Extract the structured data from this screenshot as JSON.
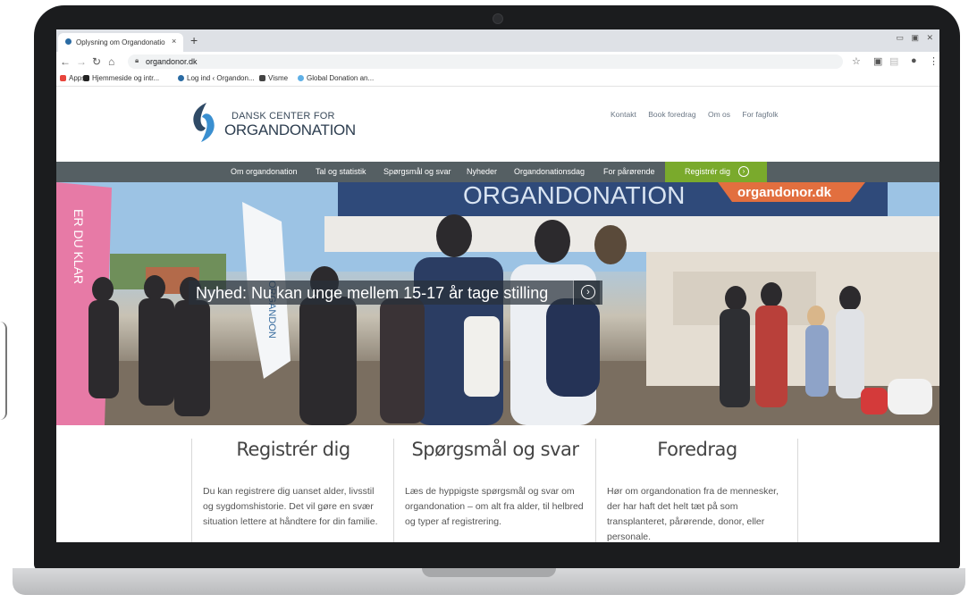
{
  "browser": {
    "tab_title": "Oplysning om Organdonation fo",
    "tab_close": "×",
    "new_tab": "+",
    "url": "organdonor.dk",
    "bookmarks": [
      {
        "label": "Apps",
        "color": "#e8453c"
      },
      {
        "label": "Hjemmeside og intr...",
        "color": "#222222"
      },
      {
        "label": "Log ind ‹ Organdon...",
        "color": "#2a6ba3"
      },
      {
        "label": "Visme",
        "color": "#444444"
      },
      {
        "label": "Global Donation an...",
        "color": "#5fb0e6"
      }
    ]
  },
  "site": {
    "logo_line1": "DANSK CENTER FOR",
    "logo_line2": "ORGANDONATION",
    "top_links": [
      "Kontakt",
      "Book foredrag",
      "Om os",
      "For fagfolk"
    ],
    "nav": [
      "Om organdonation",
      "Tal og statistik",
      "Spørgsmål og svar",
      "Nyheder",
      "Organdonationsdag",
      "For pårørende"
    ],
    "register_button": "Registrér dig",
    "brand_color": "#7aaa2c",
    "nav_color": "#555f63"
  },
  "hero": {
    "headline": "Nyhed: Nu kan unge mellem 15-17 år tage stilling",
    "banner_text": "ORGANDONATION",
    "banner_url": "organdonor.dk",
    "tent_text": "ER DU KLAR",
    "flag_text": "ORGANDON"
  },
  "cards": [
    {
      "title": "Registrér dig",
      "text": "Du kan registrere dig uanset alder, livsstil og sygdomshistorie. Det vil gøre en svær situation lettere at håndtere for din familie."
    },
    {
      "title": "Spørgsmål og svar",
      "text": "Læs de hyppigste spørgsmål og svar om organdonation – om alt fra alder, til helbred og typer af registrering."
    },
    {
      "title": "Foredrag",
      "text": "Hør om organdonation fra de mennesker, der har haft det helt tæt på som transplanteret, pårørende, donor, eller personale."
    }
  ]
}
